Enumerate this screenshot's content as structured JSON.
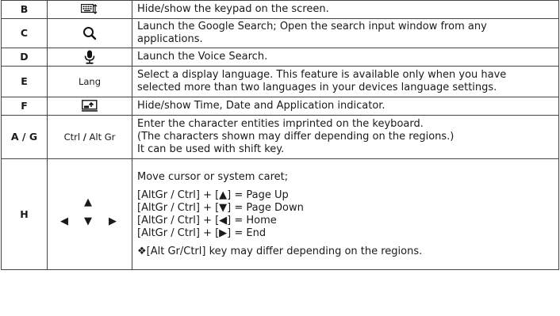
{
  "rows": [
    {
      "key": "B",
      "icon": "keypad-toggle-icon",
      "desc": "Hide/show the keypad on the screen."
    },
    {
      "key": "C",
      "icon": "search-icon",
      "desc_lines": [
        "Launch the Google Search; Open the search input window from any",
        "applications."
      ]
    },
    {
      "key": "D",
      "icon": "microphone-icon",
      "desc": "Launch the Voice Search."
    },
    {
      "key": "E",
      "icon_text": "Lang",
      "desc_lines": [
        "Select a display language. This feature is available only when you have",
        "selected more than two languages in your devices language settings."
      ]
    },
    {
      "key": "F",
      "icon": "indicator-toggle-icon",
      "desc": "Hide/show Time, Date and Application indicator."
    },
    {
      "key": "A / G",
      "icon_text_left": "Ctrl",
      "icon_sep": "/",
      "icon_text_right": "Alt Gr",
      "desc_lines": [
        "Enter the character entities imprinted on the keyboard.",
        "(The characters shown may differ depending on the regions.)",
        "It can be used with shift key."
      ]
    },
    {
      "key": "H",
      "arrows": {
        "up": "▲",
        "left": "◀",
        "down": "▼",
        "right": "▶"
      },
      "desc_intro": "Move cursor or system caret;",
      "desc_lines": [
        "[AltGr / Ctrl] + [▲] = Page Up",
        "[AltGr / Ctrl] + [▼] = Page Down",
        "[AltGr / Ctrl] + [◀] = Home",
        "[AltGr / Ctrl] + [▶] = End"
      ],
      "desc_note": "❖[Alt Gr/Ctrl] key may differ depending on the regions."
    }
  ]
}
